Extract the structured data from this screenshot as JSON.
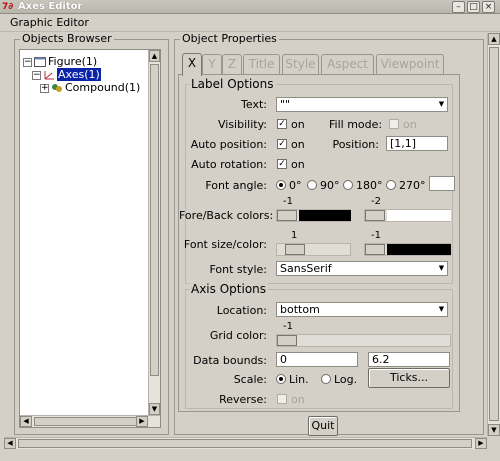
{
  "window": {
    "title": "Axes Editor",
    "app_icon": "scilab-icon",
    "controls": [
      "minimize-icon",
      "maximize-icon",
      "close-icon"
    ]
  },
  "menu": {
    "graphic_editor": "Graphic Editor"
  },
  "objects_browser": {
    "title": "Objects Browser",
    "nodes": [
      {
        "label": "Figure(1)",
        "expander": "−"
      },
      {
        "label": "Axes(1)",
        "expander": "−",
        "selected": true
      },
      {
        "label": "Compound(1)",
        "expander": "+"
      }
    ]
  },
  "object_properties": {
    "title": "Object Properties",
    "tabs": [
      "X",
      "Y",
      "Z",
      "Title",
      "Style",
      "Aspect",
      "Viewpoint"
    ],
    "active_tab": "X",
    "label_options": {
      "title": "Label Options",
      "text_label": "Text:",
      "text_value": "\"\"",
      "visibility_label": "Visibility:",
      "visibility_on": "on",
      "visibility_checked": true,
      "fill_mode_label": "Fill mode:",
      "fill_mode_on": "on",
      "fill_mode_checked": false,
      "auto_position_label": "Auto position:",
      "auto_position_on": "on",
      "auto_position_checked": true,
      "position_label": "Position:",
      "position_value": "[1,1]",
      "auto_rotation_label": "Auto rotation:",
      "auto_rotation_on": "on",
      "auto_rotation_checked": true,
      "font_angle_label": "Font angle:",
      "font_angle_options": [
        "0°",
        "90°",
        "180°",
        "270°"
      ],
      "font_angle_selected": "0°",
      "fore_back_label": "Fore/Back colors:",
      "fore_color_value": "-1",
      "back_color_value": "-2",
      "font_size_color_label": "Font size/color:",
      "font_size_value": "1",
      "font_color_value": "-1",
      "font_style_label": "Font style:",
      "font_style_value": "SansSerif"
    },
    "axis_options": {
      "title": "Axis Options",
      "location_label": "Location:",
      "location_value": "bottom",
      "grid_color_label": "Grid color:",
      "grid_color_value": "-1",
      "data_bounds_label": "Data bounds:",
      "data_bounds_min": "0",
      "data_bounds_max": "6.2",
      "scale_label": "Scale:",
      "scale_options": [
        "Lin.",
        "Log."
      ],
      "scale_selected": "Lin.",
      "ticks_button": "Ticks...",
      "reverse_label": "Reverse:",
      "reverse_on": "on",
      "reverse_checked": false
    },
    "quit_button": "Quit"
  },
  "colors": {
    "window_bg": "#d4d0c8",
    "selection": "#0a24a8",
    "disabled_text": "#a8a49b",
    "color_swatch_black": "#000000",
    "color_swatch_white": "#ffffff"
  }
}
